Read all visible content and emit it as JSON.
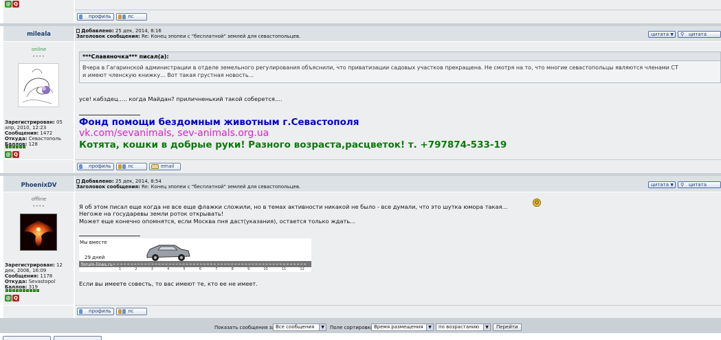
{
  "buttons": {
    "profile": "профиль",
    "pm": "лс",
    "email": "email",
    "quote1": "цитата",
    "quote2": "цитата"
  },
  "post_labels": {
    "added": "Добавлено:",
    "subject": "Заголовок сообщения:",
    "registered": "Зарегистрирован:",
    "messages": "Сообщения:",
    "from": "Откуда:",
    "points": "Баллов:"
  },
  "posts": [
    {
      "author": "mileala",
      "status": "online",
      "stars": "••••",
      "date": "25 дек, 2014, 8:16",
      "subject": "Re: Конец эпопеи с \"бесплатной\" землей для севастопольцев.",
      "registered": "05 апр, 2010, 12:23",
      "messages": "1472",
      "from": "Севастополь",
      "points": "128",
      "quote_author": "***Славяночка*** писал(а):",
      "quote_line1": "Вчера в Гагаринской администрации в отделе земельного регулирования объяснили, что приватизации садовых участков прекращена. Не смотря на то, что многие севастопольцы являются членами СТ",
      "quote_line2": "и имеют членскую книжку... Вот такая грустная новость...",
      "body": "усе! кабздец..... когда Майдан? приличненький такой соберется....",
      "sig_line1": "Фонд помощи бездомным животным г.Севастополя",
      "sig_line2": "vk.com/sevanimals, sev-animals.org.ua",
      "sig_line3": "Котята, кошки в добрые руки! Разного возраста,расцветок! т. +797874-533-19"
    },
    {
      "author": "PhoenixDV",
      "status": "offline",
      "stars": "••••",
      "date": "25 дек, 2014, 8:54",
      "subject": "Re: Конец эпопеи с \"бесплатной\" землей для севастопольцев.",
      "registered": "12 дек, 2006, 16:09",
      "messages": "1178",
      "from": "Sevastopol",
      "points": "319",
      "body_line1": "Я об этом писал еще когда не все еще флажки сложили, но в темах активности никакой не было - все думали, что это шутка юмора такая...",
      "body_line2": "Негоже на государевы земли роток открывать!",
      "body_line3": "Может еще конечно опомнятся, если Москва пня даст(указания), остается только ждать...",
      "banner_title": "Мы вместе",
      "banner_days": "29 дней",
      "banner_site": "forum-lines.ru",
      "banner_ticks": [
        "1",
        "2",
        "3",
        "4",
        "5",
        "6",
        "7",
        "8",
        "9",
        "10",
        "11",
        "12"
      ],
      "sig": "Если вы имеете совесть, то вас имеют те, кто ее не имеет."
    }
  ],
  "footer": {
    "show_label": "Показать сообщения за:",
    "show_value": "Все сообщения",
    "sort_label": "Поле сортировки",
    "sort_value": "Время размещения",
    "order_value": "по возрастанию",
    "go": "Перейти"
  },
  "colors": {
    "sig_blue": "#0000cc",
    "sig_magenta": "#e01fd0",
    "sig_green": "#0a7a0a"
  }
}
